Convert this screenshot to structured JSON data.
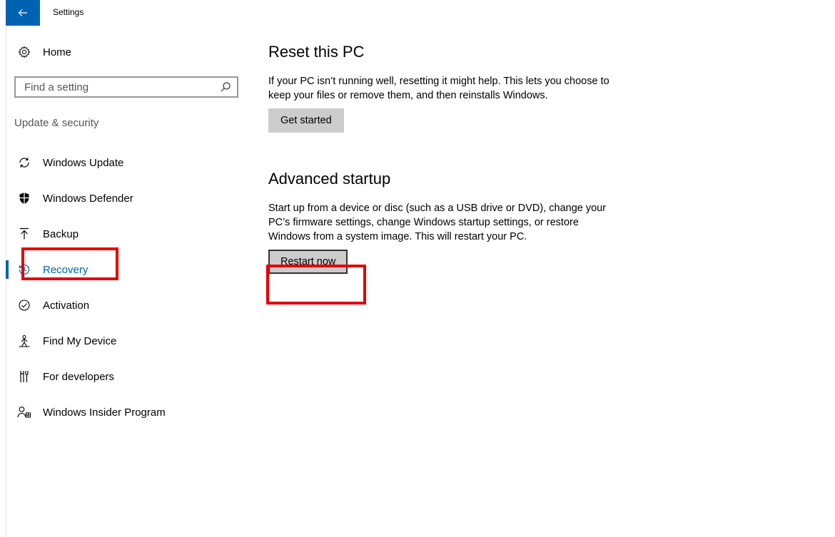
{
  "window": {
    "title": "Settings",
    "accent_color": "#0063b1",
    "back_icon": "back-arrow-icon"
  },
  "sidebar": {
    "home_label": "Home",
    "home_icon": "gear-icon",
    "search_placeholder": "Find a setting",
    "search_icon": "search-icon",
    "section_label": "Update & security",
    "items": [
      {
        "label": "Windows Update",
        "icon": "refresh-icon",
        "selected": false
      },
      {
        "label": "Windows Defender",
        "icon": "shield-icon",
        "selected": false
      },
      {
        "label": "Backup",
        "icon": "upload-arrow-icon",
        "selected": false
      },
      {
        "label": "Recovery",
        "icon": "history-icon",
        "selected": true
      },
      {
        "label": "Activation",
        "icon": "check-circle-icon",
        "selected": false
      },
      {
        "label": "Find My Device",
        "icon": "person-location-icon",
        "selected": false
      },
      {
        "label": "For developers",
        "icon": "developer-tools-icon",
        "selected": false
      },
      {
        "label": "Windows Insider Program",
        "icon": "insider-person-icon",
        "selected": false
      }
    ]
  },
  "main": {
    "reset": {
      "title": "Reset this PC",
      "description": "If your PC isn’t running well, resetting it might help. This lets you choose to keep your files or remove them, and then reinstalls Windows.",
      "button_label": "Get started"
    },
    "advanced": {
      "title": "Advanced startup",
      "description": "Start up from a device or disc (such as a USB drive or DVD), change your PC’s firmware settings, change Windows startup settings, or restore Windows from a system image. This will restart your PC.",
      "button_label": "Restart now"
    }
  },
  "annotations": {
    "highlight_color": "#e60000"
  }
}
